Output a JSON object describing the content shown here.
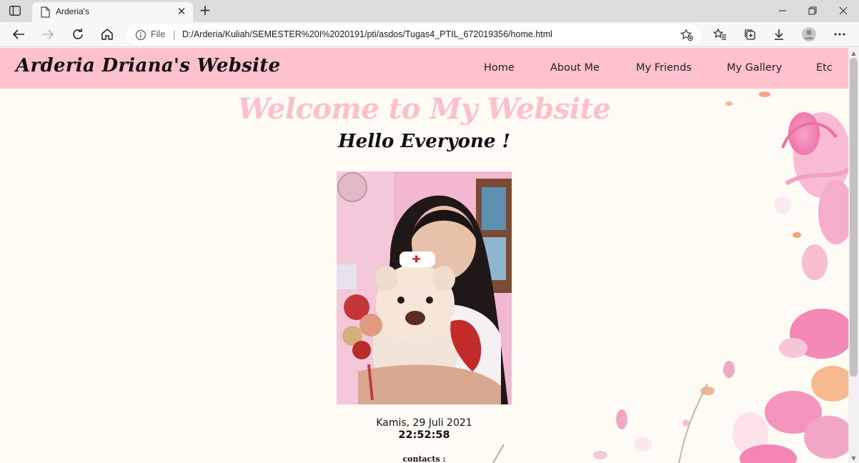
{
  "browser": {
    "tab_title": "Arderia's",
    "tab_close": "✕",
    "new_tab": "+",
    "address_scheme": "File",
    "address_separator": "|",
    "address_url": "D:/Arderia/Kuliah/SEMESTER%20I%2020191/pti/asdos/Tugas4_PTIL_672019356/home.html",
    "icons": [
      "sidebar-icon",
      "page-icon",
      "back-arrow-icon",
      "forward-arrow-icon",
      "reload-icon",
      "home-icon",
      "info-icon",
      "add-favorite-icon",
      "favorites-icon",
      "collections-icon",
      "download-icon",
      "profile-icon",
      "more-icon",
      "minimize-icon",
      "restore-icon",
      "close-icon"
    ]
  },
  "site": {
    "brand": "Arderia Driana's Website",
    "nav": [
      "Home",
      "About Me",
      "My Friends",
      "My Gallery",
      "Etc"
    ],
    "welcome": "Welcome to My Website",
    "hello": "Hello Everyone !",
    "date": "Kamis, 29 Juli 2021",
    "time": "22:52:58",
    "contacts": "contacts :"
  },
  "colors": {
    "navbar": "#ffc1cc",
    "welcome_text": "#ffbfcb",
    "page_bg": "#fdfbf4"
  }
}
